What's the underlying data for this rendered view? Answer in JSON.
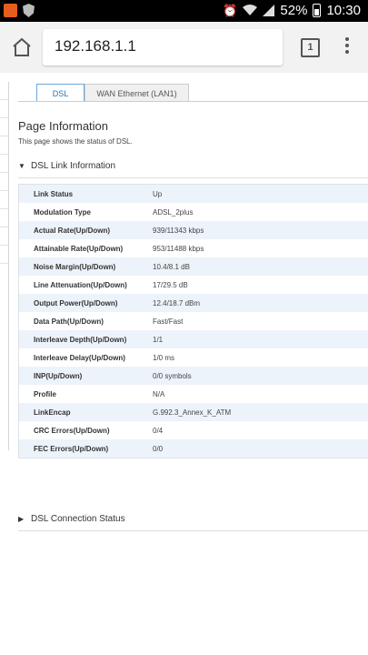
{
  "statusbar": {
    "battery": "52%",
    "time": "10:30",
    "icons": [
      "app-icon",
      "shield-icon",
      "alarm-icon",
      "wifi-icon",
      "signal-icon",
      "battery-icon"
    ]
  },
  "browser": {
    "url": "192.168.1.1",
    "tab_count": "1"
  },
  "tabs": [
    {
      "label": "DSL",
      "active": true
    },
    {
      "label": "WAN Ethernet (LAN1)",
      "active": false
    }
  ],
  "page": {
    "title": "Page Information",
    "description": "This page shows the status of DSL."
  },
  "sections": {
    "link_info": {
      "title": "DSL Link Information",
      "expanded": true
    },
    "connection_status": {
      "title": "DSL Connection Status",
      "expanded": false
    }
  },
  "link_table": [
    {
      "label": "Link Status",
      "value": "Up"
    },
    {
      "label": "Modulation Type",
      "value": "ADSL_2plus"
    },
    {
      "label": "Actual Rate(Up/Down)",
      "value": "939/11343 kbps"
    },
    {
      "label": "Attainable Rate(Up/Down)",
      "value": "953/11488 kbps"
    },
    {
      "label": "Noise Margin(Up/Down)",
      "value": "10.4/8.1 dB"
    },
    {
      "label": "Line Attenuation(Up/Down)",
      "value": "17/29.5 dB"
    },
    {
      "label": "Output Power(Up/Down)",
      "value": "12.4/18.7 dBm"
    },
    {
      "label": "Data Path(Up/Down)",
      "value": "Fast/Fast"
    },
    {
      "label": "Interleave Depth(Up/Down)",
      "value": "1/1"
    },
    {
      "label": "Interleave Delay(Up/Down)",
      "value": "1/0 ms"
    },
    {
      "label": "INP(Up/Down)",
      "value": "0/0 symbols"
    },
    {
      "label": "Profile",
      "value": "N/A"
    },
    {
      "label": "LinkEncap",
      "value": "G.992.3_Annex_K_ATM"
    },
    {
      "label": "CRC Errors(Up/Down)",
      "value": "0/4"
    },
    {
      "label": "FEC Errors(Up/Down)",
      "value": "0/0"
    }
  ],
  "colors": {
    "accent": "#1f74b8",
    "row_shade": "#edf3fa",
    "toolbar": "#f2f2f2"
  }
}
